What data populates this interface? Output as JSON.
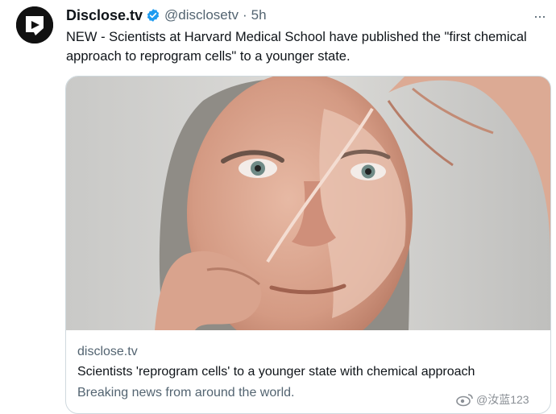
{
  "tweet": {
    "author_name": "Disclose.tv",
    "handle": "@disclosetv",
    "separator": "·",
    "time": "5h",
    "more_label": "···",
    "text": "NEW - Scientists at Harvard Medical School have published the \"first chemical approach to reprogram cells\" to a younger state.",
    "card": {
      "domain": "disclose.tv",
      "title": "Scientists 'reprogram cells' to a younger state with chemical approach",
      "description": "Breaking news from around the world."
    }
  },
  "watermark": {
    "text": "@汝蓝123"
  },
  "colors": {
    "verified": "#1d9bf0",
    "secondary_text": "#536471",
    "border": "#cfd9de"
  },
  "icons": {
    "avatar": "disclose-logo-icon",
    "verified": "verified-badge-icon",
    "more": "more-dots-icon"
  }
}
